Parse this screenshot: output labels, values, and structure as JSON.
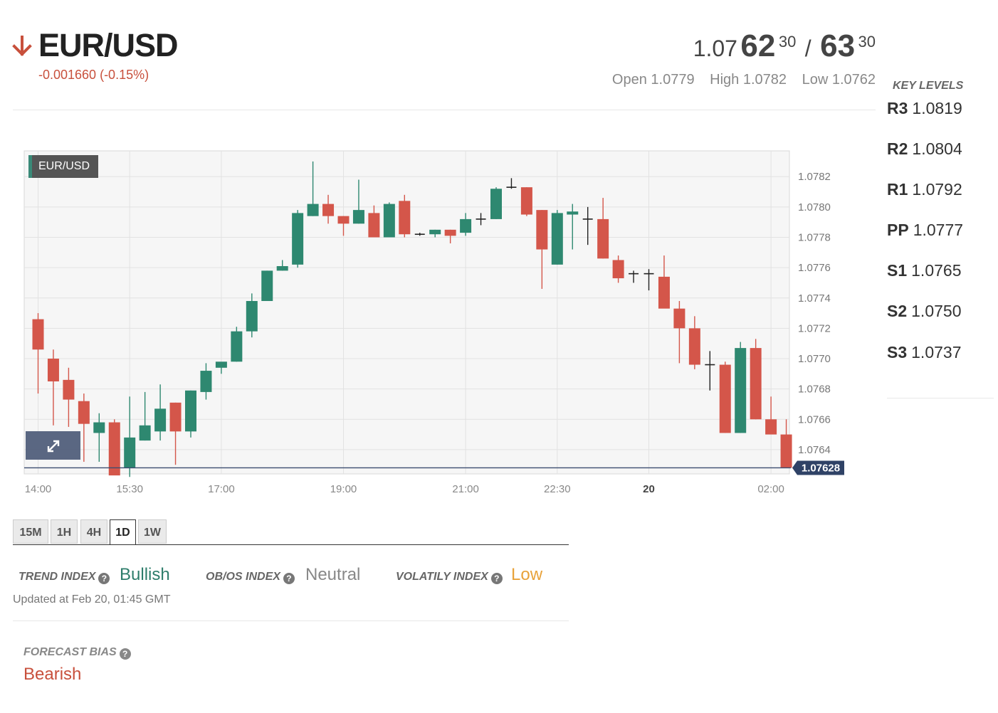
{
  "header": {
    "symbol": "EUR/USD",
    "change": "-0.001660 (-0.15%)",
    "direction_icon": "arrow-down-icon",
    "bid_prefix": "1.07",
    "bid_big": "62",
    "bid_sup": "30",
    "separator": "/",
    "ask_big": "63",
    "ask_sup": "30",
    "open": "Open 1.0779",
    "high": "High 1.0782",
    "low": "Low 1.0762"
  },
  "key_levels": {
    "title": "KEY LEVELS",
    "levels": [
      {
        "name": "R3",
        "value": "1.0819"
      },
      {
        "name": "R2",
        "value": "1.0804"
      },
      {
        "name": "R1",
        "value": "1.0792"
      },
      {
        "name": "PP",
        "value": "1.0777"
      },
      {
        "name": "S1",
        "value": "1.0765"
      },
      {
        "name": "S2",
        "value": "1.0750"
      },
      {
        "name": "S3",
        "value": "1.0737"
      }
    ]
  },
  "colors": {
    "up": "#2e8870",
    "down": "#d4564a",
    "bullish": "#2e7d6b",
    "neutral": "#888888",
    "low": "#e8a23a",
    "bearish": "#c8503c"
  },
  "chart_data": {
    "type": "candlestick",
    "title": "EUR/USD",
    "x_ticks": [
      {
        "label": "14:00",
        "index": 0
      },
      {
        "label": "15:30",
        "index": 6
      },
      {
        "label": "17:00",
        "index": 12
      },
      {
        "label": "19:00",
        "index": 20
      },
      {
        "label": "21:00",
        "index": 28
      },
      {
        "label": "22:30",
        "index": 34
      },
      {
        "label": "20",
        "index": 40,
        "bold": true
      },
      {
        "label": "02:00",
        "index": 48
      }
    ],
    "y_ticks": [
      "1.0782",
      "1.0780",
      "1.0778",
      "1.0776",
      "1.0774",
      "1.0772",
      "1.0770",
      "1.0768",
      "1.0766",
      "1.0764"
    ],
    "ylim": [
      1.07624,
      1.07837
    ],
    "current_price": 1.07628,
    "current_price_label": "1.07628",
    "candles": [
      {
        "o": 1.07726,
        "h": 1.0773,
        "l": 1.07677,
        "c": 1.07706
      },
      {
        "o": 1.077,
        "h": 1.07706,
        "l": 1.07656,
        "c": 1.07685
      },
      {
        "o": 1.07686,
        "h": 1.07694,
        "l": 1.07655,
        "c": 1.07673
      },
      {
        "o": 1.07672,
        "h": 1.07677,
        "l": 1.07632,
        "c": 1.07657
      },
      {
        "o": 1.07651,
        "h": 1.07664,
        "l": 1.07632,
        "c": 1.07658
      },
      {
        "o": 1.07658,
        "h": 1.0766,
        "l": 1.0763,
        "c": 1.07623
      },
      {
        "o": 1.07628,
        "h": 1.07675,
        "l": 1.07622,
        "c": 1.07648
      },
      {
        "o": 1.07646,
        "h": 1.07678,
        "l": 1.07646,
        "c": 1.07656
      },
      {
        "o": 1.07652,
        "h": 1.07683,
        "l": 1.07646,
        "c": 1.07667
      },
      {
        "o": 1.07671,
        "h": 1.07671,
        "l": 1.0763,
        "c": 1.07652
      },
      {
        "o": 1.07652,
        "h": 1.07679,
        "l": 1.07648,
        "c": 1.07679
      },
      {
        "o": 1.07678,
        "h": 1.07697,
        "l": 1.07673,
        "c": 1.07692
      },
      {
        "o": 1.07694,
        "h": 1.07697,
        "l": 1.0769,
        "c": 1.07698
      },
      {
        "o": 1.07698,
        "h": 1.07721,
        "l": 1.07698,
        "c": 1.07718
      },
      {
        "o": 1.07718,
        "h": 1.07743,
        "l": 1.07714,
        "c": 1.07738
      },
      {
        "o": 1.07738,
        "h": 1.07758,
        "l": 1.07738,
        "c": 1.07758
      },
      {
        "o": 1.07758,
        "h": 1.07765,
        "l": 1.07758,
        "c": 1.07761
      },
      {
        "o": 1.07762,
        "h": 1.07798,
        "l": 1.0776,
        "c": 1.07796
      },
      {
        "o": 1.07794,
        "h": 1.0783,
        "l": 1.07794,
        "c": 1.07802
      },
      {
        "o": 1.07802,
        "h": 1.07808,
        "l": 1.07789,
        "c": 1.07794
      },
      {
        "o": 1.07794,
        "h": 1.07794,
        "l": 1.07781,
        "c": 1.07789
      },
      {
        "o": 1.07789,
        "h": 1.07818,
        "l": 1.07789,
        "c": 1.07798
      },
      {
        "o": 1.07796,
        "h": 1.07801,
        "l": 1.07783,
        "c": 1.0778
      },
      {
        "o": 1.0778,
        "h": 1.07803,
        "l": 1.0778,
        "c": 1.07802
      },
      {
        "o": 1.07804,
        "h": 1.07808,
        "l": 1.0778,
        "c": 1.07782
      },
      {
        "o": 1.07782,
        "h": 1.07783,
        "l": 1.07781,
        "c": 1.07782
      },
      {
        "o": 1.07782,
        "h": 1.07785,
        "l": 1.0778,
        "c": 1.07785
      },
      {
        "o": 1.07785,
        "h": 1.07785,
        "l": 1.07776,
        "c": 1.07781
      },
      {
        "o": 1.07783,
        "h": 1.07796,
        "l": 1.07781,
        "c": 1.07792
      },
      {
        "o": 1.07792,
        "h": 1.07796,
        "l": 1.07788,
        "c": 1.07792
      },
      {
        "o": 1.07792,
        "h": 1.07813,
        "l": 1.07792,
        "c": 1.07812
      },
      {
        "o": 1.07813,
        "h": 1.07819,
        "l": 1.07812,
        "c": 1.07813
      },
      {
        "o": 1.07813,
        "h": 1.07813,
        "l": 1.07794,
        "c": 1.07795
      },
      {
        "o": 1.07798,
        "h": 1.07798,
        "l": 1.07746,
        "c": 1.07772
      },
      {
        "o": 1.07762,
        "h": 1.07798,
        "l": 1.07762,
        "c": 1.07796
      },
      {
        "o": 1.07795,
        "h": 1.07802,
        "l": 1.07772,
        "c": 1.07797
      },
      {
        "o": 1.07792,
        "h": 1.078,
        "l": 1.07775,
        "c": 1.07792
      },
      {
        "o": 1.07792,
        "h": 1.07806,
        "l": 1.07766,
        "c": 1.07766
      },
      {
        "o": 1.07765,
        "h": 1.07768,
        "l": 1.0775,
        "c": 1.07753
      },
      {
        "o": 1.07756,
        "h": 1.07758,
        "l": 1.0775,
        "c": 1.07756
      },
      {
        "o": 1.07757,
        "h": 1.07759,
        "l": 1.07745,
        "c": 1.07756
      },
      {
        "o": 1.07754,
        "h": 1.07768,
        "l": 1.07737,
        "c": 1.07733
      },
      {
        "o": 1.07733,
        "h": 1.07738,
        "l": 1.07697,
        "c": 1.0772
      },
      {
        "o": 1.0772,
        "h": 1.07728,
        "l": 1.07693,
        "c": 1.07696
      },
      {
        "o": 1.07696,
        "h": 1.07705,
        "l": 1.07679,
        "c": 1.07696
      },
      {
        "o": 1.07696,
        "h": 1.07698,
        "l": 1.07651,
        "c": 1.07651
      },
      {
        "o": 1.07651,
        "h": 1.07711,
        "l": 1.07651,
        "c": 1.07707
      },
      {
        "o": 1.07707,
        "h": 1.07713,
        "l": 1.0766,
        "c": 1.0766
      },
      {
        "o": 1.0766,
        "h": 1.07675,
        "l": 1.07655,
        "c": 1.0765
      },
      {
        "o": 1.0765,
        "h": 1.0766,
        "l": 1.07628,
        "c": 1.07628
      }
    ]
  },
  "timeframe_tabs": [
    {
      "label": "15M",
      "active": false
    },
    {
      "label": "1H",
      "active": false
    },
    {
      "label": "4H",
      "active": false
    },
    {
      "label": "1D",
      "active": true
    },
    {
      "label": "1W",
      "active": false
    }
  ],
  "indices": {
    "trend_label": "TREND INDEX",
    "trend_value": "Bullish",
    "obos_label": "OB/OS INDEX",
    "obos_value": "Neutral",
    "volatility_label": "VOLATILY INDEX",
    "volatility_value": "Low",
    "help_glyph": "?",
    "updated": "Updated at Feb 20, 01:45 GMT"
  },
  "forecast": {
    "label": "FORECAST BIAS",
    "value": "Bearish"
  }
}
